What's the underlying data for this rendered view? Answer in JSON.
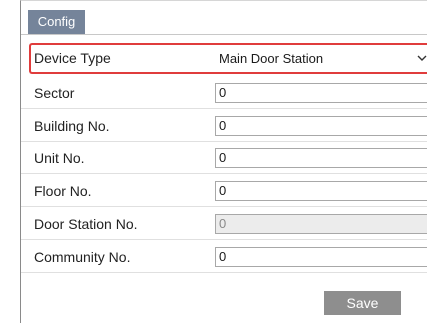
{
  "tab": {
    "label": "Config"
  },
  "form": {
    "device_type": {
      "label": "Device Type",
      "value": "Main Door Station"
    },
    "sector": {
      "label": "Sector",
      "value": "0"
    },
    "building_no": {
      "label": "Building No.",
      "value": "0"
    },
    "unit_no": {
      "label": "Unit No.",
      "value": "0"
    },
    "floor_no": {
      "label": "Floor No.",
      "value": "0"
    },
    "door_station_no": {
      "label": "Door Station No.",
      "value": "0"
    },
    "community_no": {
      "label": "Community No.",
      "value": "0"
    }
  },
  "actions": {
    "save_label": "Save"
  },
  "colors": {
    "tab_bg": "#75849a",
    "highlight_border": "#e03c3c",
    "button_bg": "#8e8e8e"
  }
}
